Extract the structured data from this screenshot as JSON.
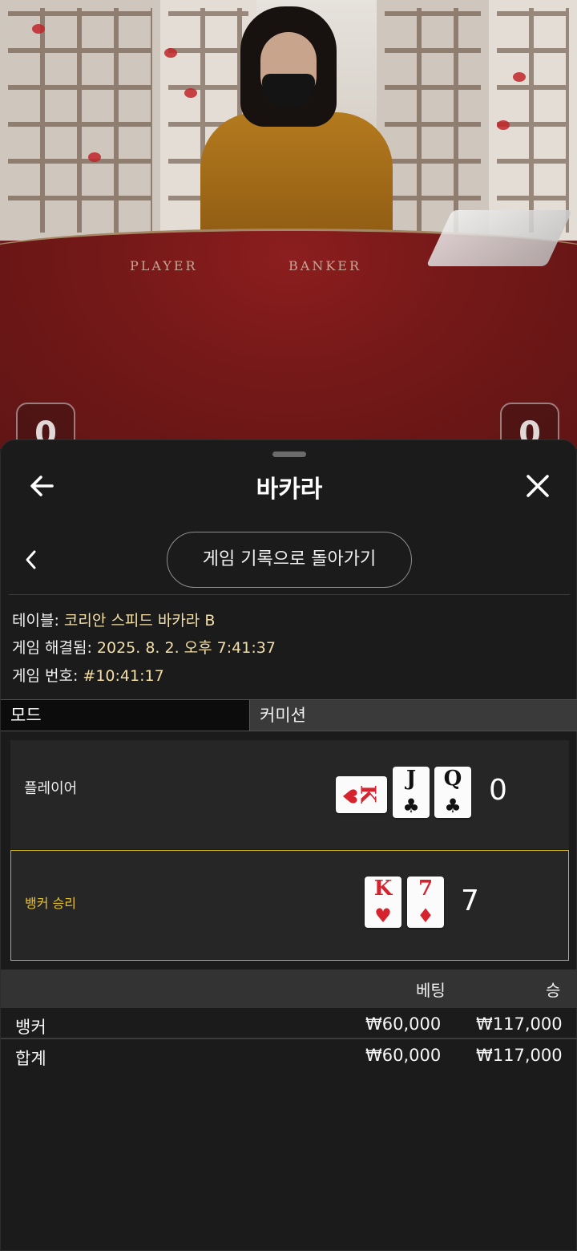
{
  "video": {
    "felt_player": "PLAYER",
    "felt_banker": "BANKER",
    "left_score": "0",
    "right_score": "0"
  },
  "header": {
    "title": "바카라",
    "back_icon": "arrow-left-icon",
    "close_icon": "close-icon"
  },
  "nav": {
    "back_to_history": "게임 기록으로 돌아가기",
    "chevron_icon": "chevron-left-icon"
  },
  "info": {
    "table_label": "테이블: ",
    "table_value": "코리안 스피드 바카라 B",
    "resolved_label": "게임 해결됨: ",
    "resolved_value": "2025. 8. 2. 오후 7:41:37",
    "game_no_label": "게임 번호: ",
    "game_no_value": "#10:41:17"
  },
  "tabs": [
    "모드",
    "커미션"
  ],
  "player": {
    "label": "플레이어",
    "score": "0",
    "cards": [
      {
        "rank": "K",
        "suit": "♥",
        "color": "red",
        "rotated": true
      },
      {
        "rank": "J",
        "suit": "♣",
        "color": "black"
      },
      {
        "rank": "Q",
        "suit": "♣",
        "color": "black"
      }
    ]
  },
  "banker": {
    "label": "뱅커 승리",
    "score": "7",
    "cards": [
      {
        "rank": "K",
        "suit": "♥",
        "color": "red"
      },
      {
        "rank": "7",
        "suit": "♦",
        "color": "red"
      }
    ]
  },
  "bets": {
    "col_bet": "베팅",
    "col_win": "승",
    "rows": [
      {
        "name": "뱅커",
        "bet": "₩60,000",
        "win": "₩117,000"
      },
      {
        "name": "합계",
        "bet": "₩60,000",
        "win": "₩117,000"
      }
    ]
  },
  "colors": {
    "accent_gold": "#c9ad26",
    "info_value": "#f3dfa6",
    "card_red": "#d6242e"
  }
}
